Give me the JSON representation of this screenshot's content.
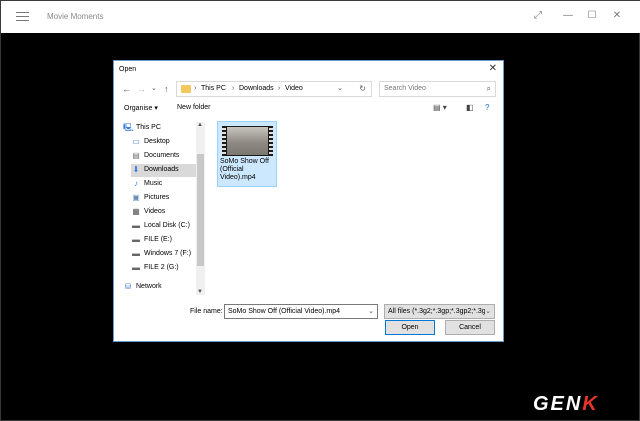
{
  "app": {
    "title": "Movie Moments"
  },
  "dialog": {
    "title": "Open",
    "close_glyph": "✕",
    "breadcrumb": [
      "This PC",
      "Downloads",
      "Video"
    ],
    "search_placeholder": "Search Video",
    "toolbar": {
      "organise": "Organise ▾",
      "new_folder": "New folder"
    },
    "tree": [
      {
        "label": "This PC",
        "icon": "computer-icon"
      },
      {
        "label": "Desktop",
        "icon": "desktop-icon"
      },
      {
        "label": "Documents",
        "icon": "documents-icon"
      },
      {
        "label": "Downloads",
        "icon": "download-icon",
        "selected": true
      },
      {
        "label": "Music",
        "icon": "music-icon"
      },
      {
        "label": "Pictures",
        "icon": "pictures-icon"
      },
      {
        "label": "Videos",
        "icon": "videos-icon"
      },
      {
        "label": "Local Disk (C:)",
        "icon": "drive-icon"
      },
      {
        "label": "FILE (E:)",
        "icon": "drive-icon"
      },
      {
        "label": "Windows 7 (F:)",
        "icon": "drive-icon"
      },
      {
        "label": "FILE 2 (G:)",
        "icon": "drive-icon"
      },
      {
        "label": "Network",
        "icon": "network-icon"
      }
    ],
    "files": [
      {
        "name": "SoMo  Show Off (Official Video).mp4"
      }
    ],
    "file_name_label": "File name:",
    "file_name_value": "SoMo  Show Off (Official Video).mp4",
    "filter_value": "All files (*.3g2;*.3gp;*.3gp2;*.3g",
    "open_label": "Open",
    "cancel_label": "Cancel"
  },
  "watermark": {
    "logo_text": "GEN",
    "logo_accent": "K"
  },
  "colors": {
    "selection": "#cce8ff",
    "accent": "#0078d7",
    "logo_red": "#e8352a"
  }
}
